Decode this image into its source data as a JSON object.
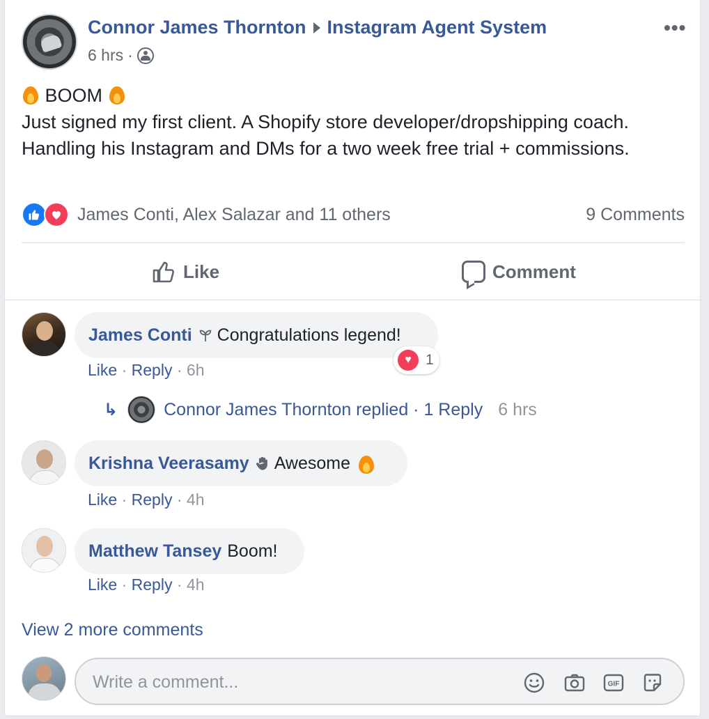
{
  "post": {
    "author": "Connor James Thornton",
    "group": "Instagram Agent System",
    "time": "6 hrs",
    "separator": "·",
    "more": "•••",
    "headline": "BOOM",
    "body": "Just signed my first client. A Shopify store developer/dropshipping coach. Handling his Instagram and DMs for a two week free trial + commissions.",
    "reactions_text": "James Conti, Alex Salazar and 11 others",
    "comments_count": "9 Comments",
    "like_label": "Like",
    "comment_label": "Comment"
  },
  "comments": [
    {
      "name": "James Conti",
      "text": "Congratulations legend!",
      "like": "Like",
      "reply": "Reply",
      "time": "6h",
      "reaction_count": "1",
      "reply_summary": {
        "text": "Connor James Thornton replied · 1 Reply",
        "time": "6 hrs"
      }
    },
    {
      "name": "Krishna Veerasamy",
      "text": "Awesome",
      "like": "Like",
      "reply": "Reply",
      "time": "4h"
    },
    {
      "name": "Matthew Tansey",
      "text": "Boom!",
      "like": "Like",
      "reply": "Reply",
      "time": "4h"
    }
  ],
  "view_more": "View 2 more comments",
  "composer": {
    "placeholder": "Write a comment..."
  },
  "colors": {
    "link": "#385898",
    "like_blue": "#1877f2",
    "love_red": "#f33e58"
  }
}
